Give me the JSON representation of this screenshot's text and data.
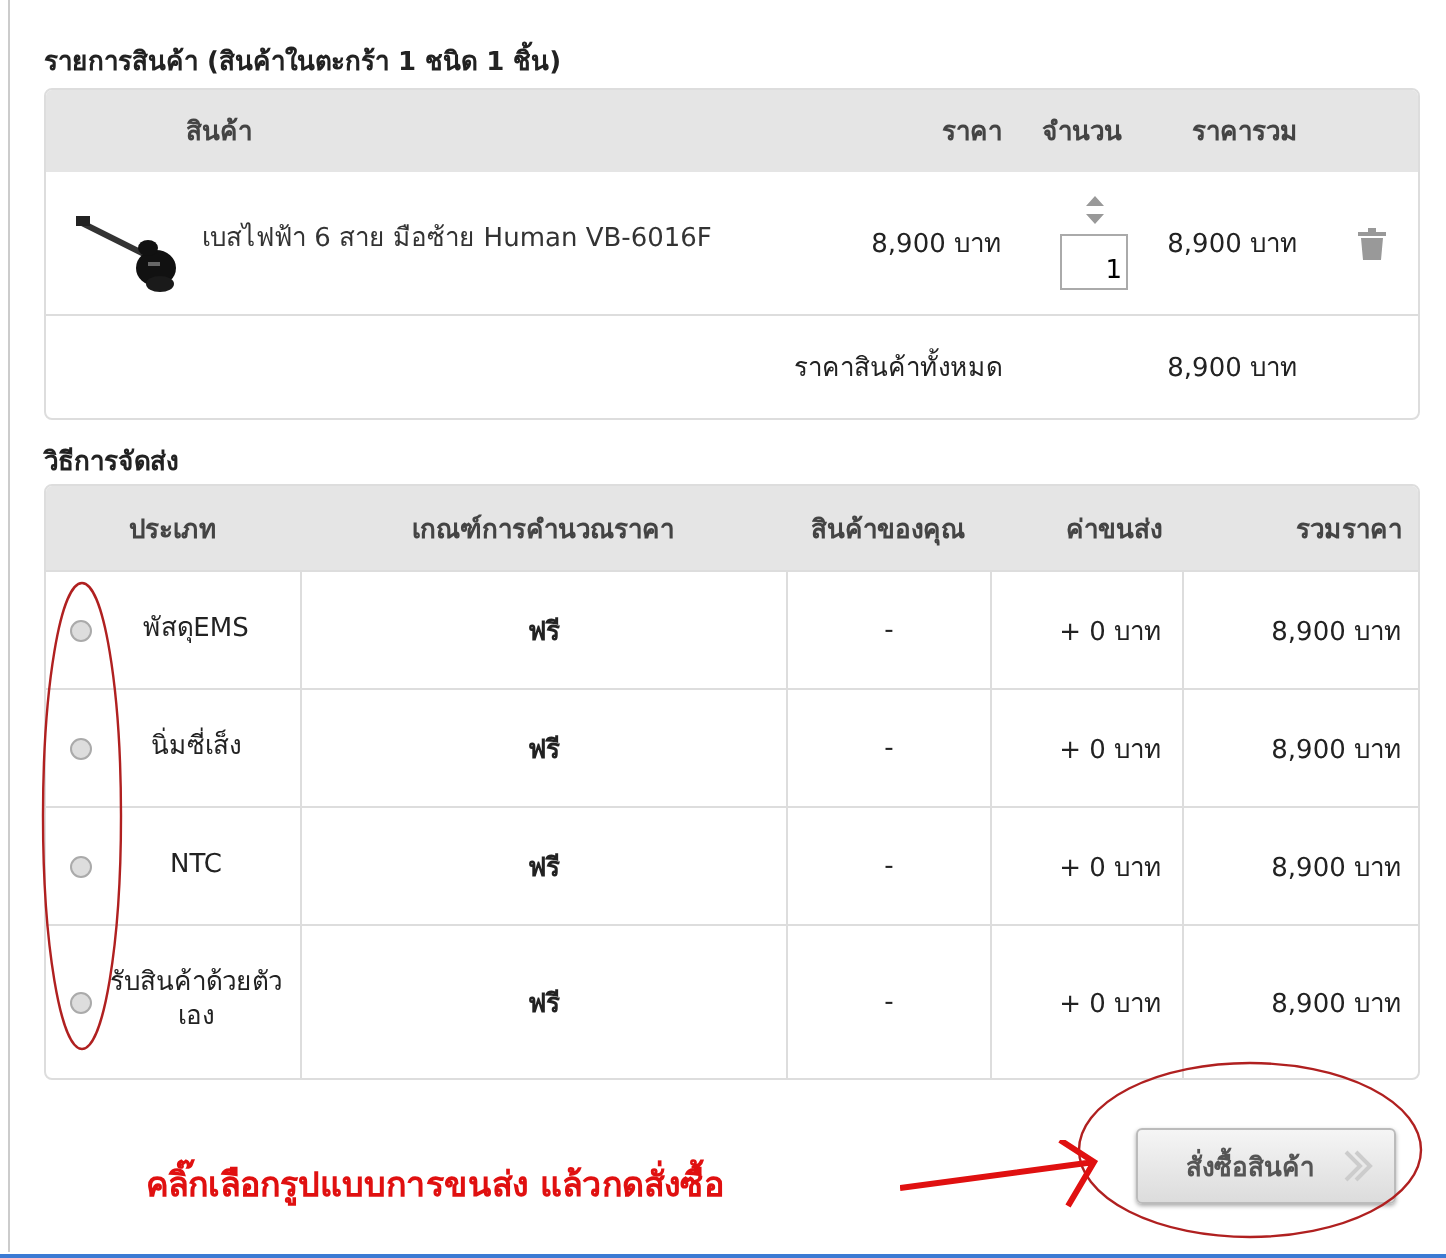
{
  "cart": {
    "title": "รายการสินค้า (สินค้าในตะกร้า 1 ชนิด 1 ชิ้น)",
    "columns": [
      "สินค้า",
      "ราคา",
      "จำนวน",
      "ราคารวม"
    ],
    "items": [
      {
        "name": "เบสไฟฟ้า 6 สาย มือซ้าย Human VB-6016F",
        "price": "8,900 บาท",
        "quantity": "1",
        "total": "8,900 บาท"
      }
    ],
    "summary": {
      "label": "ราคาสินค้าทั้งหมด",
      "value": "8,900 บาท"
    }
  },
  "shipping": {
    "title": "วิธีการจัดส่ง",
    "columns": [
      "ประเภท",
      "เกณฑ์การคำนวณราคา",
      "สินค้าของคุณ",
      "ค่าขนส่ง",
      "รวมราคา"
    ],
    "options": [
      {
        "type": "พัสดุEMS",
        "selected": false,
        "rule": "ฟรี",
        "your_items": "-",
        "fee": "+ 0 บาท",
        "total": "8,900 บาท"
      },
      {
        "type": "นิ่มซี่เส็ง",
        "selected": false,
        "rule": "ฟรี",
        "your_items": "-",
        "fee": "+ 0 บาท",
        "total": "8,900 บาท"
      },
      {
        "type": "NTC",
        "selected": false,
        "rule": "ฟรี",
        "your_items": "-",
        "fee": "+ 0 บาท",
        "total": "8,900 บาท"
      },
      {
        "type": "รับสินค้าด้วยตัวเอง",
        "selected": false,
        "rule": "ฟรี",
        "your_items": "-",
        "fee": "+ 0 บาท",
        "total": "8,900 บาท"
      }
    ]
  },
  "order_button": {
    "label": "สั่งซื้อสินค้า"
  },
  "annotation": {
    "text": "คลิ๊กเลือกรูปแบบการขนส่ง แล้วกดสั่งซื้อ"
  }
}
